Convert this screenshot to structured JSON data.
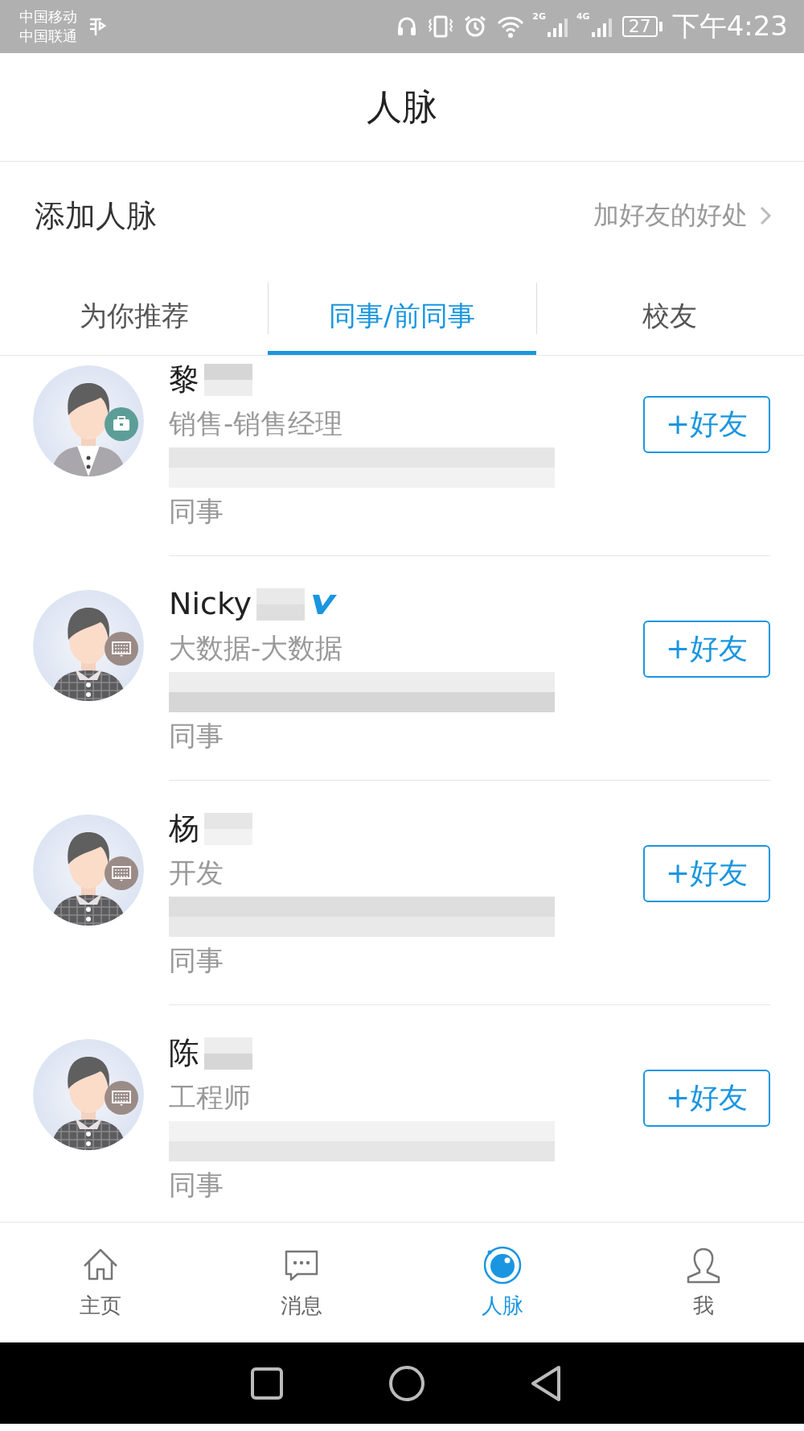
{
  "status_bar": {
    "carriers": [
      "中国移动",
      "中国联通"
    ],
    "network_labels": [
      "2G",
      "4G"
    ],
    "battery": "27",
    "time": "下午4:23"
  },
  "header": {
    "title": "人脉"
  },
  "add_contacts": {
    "title": "添加人脉",
    "link": "加好友的好处"
  },
  "tabs": [
    {
      "label": "为你推荐",
      "selected": false
    },
    {
      "label": "同事/前同事",
      "selected": true
    },
    {
      "label": "校友",
      "selected": false
    }
  ],
  "contacts": [
    {
      "name": "黎",
      "verified": false,
      "kind": "briefcase",
      "title": "销售-销售经理",
      "relation": "同事",
      "button": "+好友"
    },
    {
      "name": "Nicky",
      "verified": true,
      "kind": "keyboard",
      "title": "大数据-大数据",
      "relation": "同事",
      "button": "+好友"
    },
    {
      "name": "杨",
      "verified": false,
      "kind": "keyboard",
      "title": "开发",
      "relation": "同事",
      "button": "+好友"
    },
    {
      "name": "陈",
      "verified": false,
      "kind": "keyboard",
      "title": "工程师",
      "relation": "同事",
      "button": "+好友"
    }
  ],
  "bottom_nav": [
    {
      "label": "主页",
      "kind": "home",
      "selected": false
    },
    {
      "label": "消息",
      "kind": "message",
      "selected": false
    },
    {
      "label": "人脉",
      "kind": "contacts",
      "selected": true
    },
    {
      "label": "我",
      "kind": "profile",
      "selected": false
    }
  ]
}
